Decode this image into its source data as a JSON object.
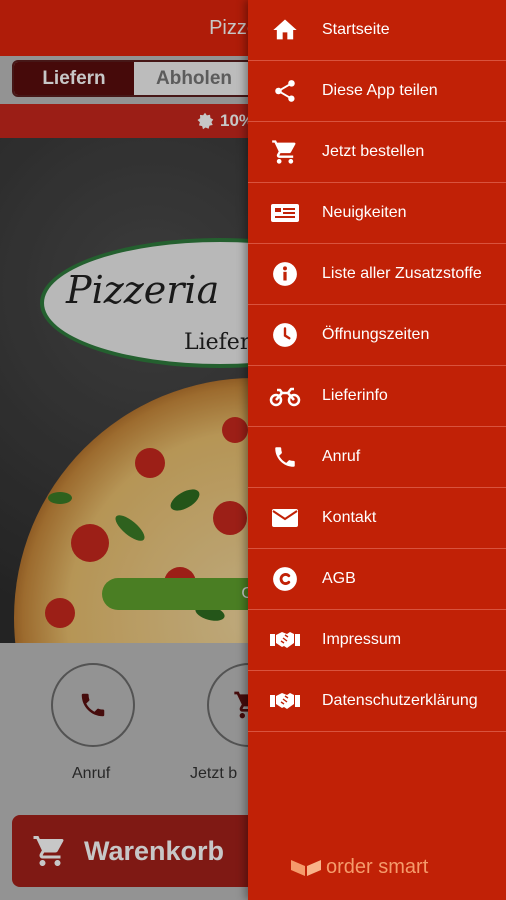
{
  "header": {
    "title": "Pizzeria d"
  },
  "order_tabs": [
    {
      "label": "Liefern",
      "active": true
    },
    {
      "label": "Abholen",
      "active": false
    }
  ],
  "promo": {
    "text": "10%"
  },
  "hero": {
    "logo_name": "Pizzeria",
    "logo_sub": "Liefer",
    "cta_label": "Ge"
  },
  "quick_actions": [
    {
      "label": "Anruf",
      "icon": "phone-icon"
    },
    {
      "label": "Jetzt b",
      "icon": "cart-icon"
    }
  ],
  "cart": {
    "label": "Warenkorb",
    "icon": "cart-icon"
  },
  "drawer": {
    "items": [
      {
        "label": "Startseite",
        "icon": "home-icon"
      },
      {
        "label": "Diese App teilen",
        "icon": "share-icon"
      },
      {
        "label": "Jetzt bestellen",
        "icon": "cart-icon"
      },
      {
        "label": "Neuigkeiten",
        "icon": "news-icon"
      },
      {
        "label": "Liste aller Zusatzstoffe",
        "icon": "info-icon"
      },
      {
        "label": "Öffnungszeiten",
        "icon": "clock-icon"
      },
      {
        "label": "Lieferinfo",
        "icon": "motorbike-icon"
      },
      {
        "label": "Anruf",
        "icon": "phone-icon"
      },
      {
        "label": "Kontakt",
        "icon": "mail-icon"
      },
      {
        "label": "AGB",
        "icon": "copyright-icon"
      },
      {
        "label": "Impressum",
        "icon": "handshake-icon"
      },
      {
        "label": "Datenschutzerklärung",
        "icon": "handshake-icon"
      }
    ],
    "footer_brand": "order smart"
  },
  "colors": {
    "brand_red": "#e0250c",
    "drawer_red": "#c12106",
    "dark_red": "#5a0e0e",
    "green": "#5fa22e"
  }
}
